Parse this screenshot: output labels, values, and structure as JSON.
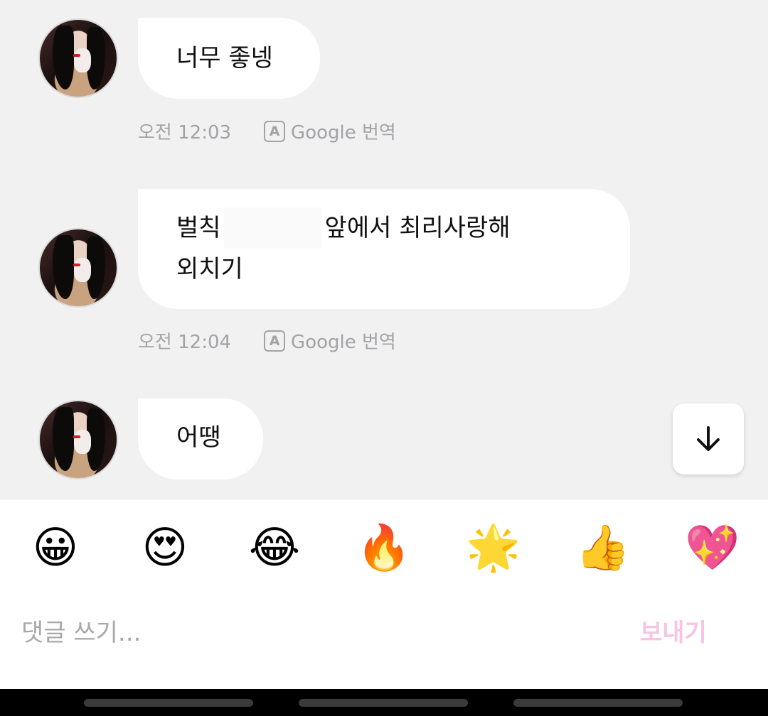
{
  "messages": [
    {
      "lines": [
        "너무 좋넹"
      ],
      "time": "오전 12:03",
      "translate": "Google 번역"
    },
    {
      "line1_before": "벌칙",
      "line1_after": "앞에서 최리사랑해",
      "line2": "외치기",
      "time": "오전 12:04",
      "translate": "Google 번역"
    },
    {
      "lines": [
        "어땡"
      ]
    }
  ],
  "reactions": [
    "😀",
    "😍",
    "😂",
    "🔥",
    "🌟",
    "👍",
    "💖"
  ],
  "reaction_names": [
    "grinning-face",
    "heart-eyes",
    "tears-of-joy",
    "fire",
    "glowing-star",
    "thumbs-up",
    "sparkling-heart"
  ],
  "composer": {
    "placeholder": "댓글 쓰기...",
    "send_label": "보내기"
  },
  "colors": {
    "background": "#f1f1f2",
    "bubble": "#ffffff",
    "meta_text": "#a3a3a6",
    "send_disabled": "#f6c5e4"
  },
  "icons": {
    "translate": "translate-a-icon",
    "scroll_down": "arrow-down-icon"
  }
}
